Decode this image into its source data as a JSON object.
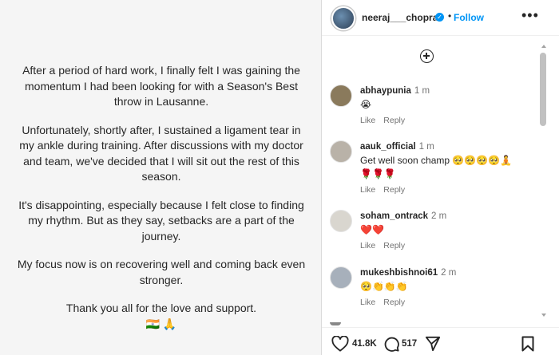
{
  "post": {
    "caption": [
      "After a period of hard work, I finally felt I was gaining the momentum I had been looking for with a Season's Best throw in Lausanne.",
      "Unfortunately, shortly after, I sustained a ligament tear in my ankle during training. After discussions with my doctor and team, we've decided that I will sit out the rest of this season.",
      "It's disappointing, especially because I felt close to finding my rhythm. But as they say, setbacks are a part of the journey.",
      "My focus now is on recovering well and coming back even stronger.",
      "Thank you all for the love and support.",
      "🇮🇳 🙏"
    ]
  },
  "header": {
    "username": "neeraj___chopra",
    "separator": "•",
    "follow_label": "Follow",
    "more_label": "•••",
    "verified_mark": "✓"
  },
  "comments": [
    {
      "username": "abhaypunia",
      "time": "1 m",
      "text": "😭",
      "text2": "",
      "like": "Like",
      "reply": "Reply",
      "avatar_color": "#8a7a5c"
    },
    {
      "username": "aauk_official",
      "time": "1 m",
      "text": "Get well soon champ 🥺🥺🥺🥺🧘",
      "text2": "🌹🌹🌹",
      "like": "Like",
      "reply": "Reply",
      "avatar_color": "#b9b2a8"
    },
    {
      "username": "soham_ontrack",
      "time": "2 m",
      "text": "❤️❤️",
      "text2": "",
      "like": "Like",
      "reply": "Reply",
      "avatar_color": "#d9d6cf"
    },
    {
      "username": "mukeshbishnoi61",
      "time": "2 m",
      "text": "🥺👏👏👏",
      "text2": "",
      "like": "Like",
      "reply": "Reply",
      "avatar_color": "#a7b0bb"
    }
  ],
  "footer": {
    "likes": "41.8K",
    "comments": "517"
  },
  "colors": {
    "accent": "#0095f6",
    "text": "#262626",
    "muted": "#737373",
    "left_bg": "#f5f5f5"
  }
}
